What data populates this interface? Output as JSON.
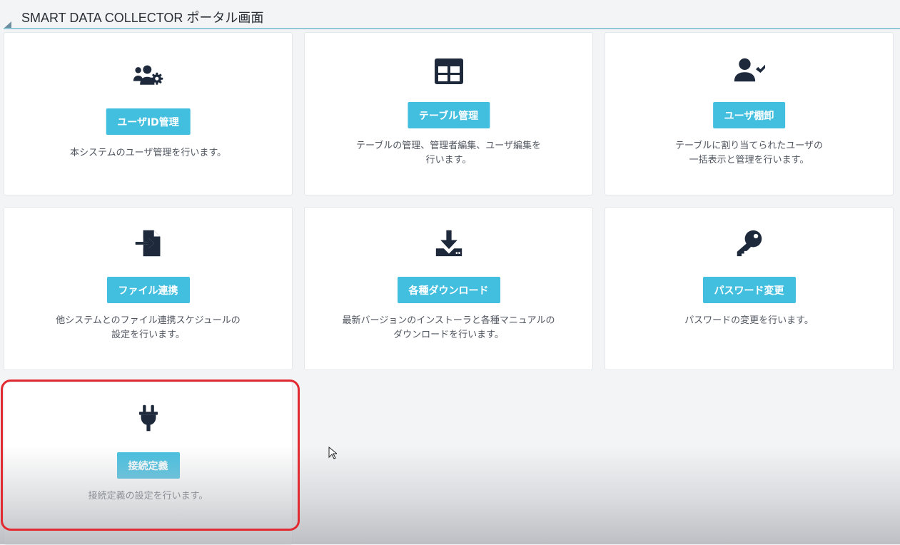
{
  "header": {
    "title": "SMART DATA COLLECTOR ポータル画面"
  },
  "cards": [
    {
      "icon": "users-cog-icon",
      "button_label": "ユーザID管理",
      "description": "本システムのユーザ管理を行います。"
    },
    {
      "icon": "table-icon",
      "button_label": "テーブル管理",
      "description": "テーブルの管理、管理者編集、ユーザ編集を\n行います。"
    },
    {
      "icon": "user-check-icon",
      "button_label": "ユーザ棚卸",
      "description": "テーブルに割り当てられたユーザの\n一括表示と管理を行います。"
    },
    {
      "icon": "file-import-icon",
      "button_label": "ファイル連携",
      "description": "他システムとのファイル連携スケジュールの\n設定を行います。"
    },
    {
      "icon": "download-icon",
      "button_label": "各種ダウンロード",
      "description": "最新バージョンのインストーラと各種マニュアルの\nダウンロードを行います。"
    },
    {
      "icon": "key-icon",
      "button_label": "パスワード変更",
      "description": "パスワードの変更を行います。"
    },
    {
      "icon": "plug-icon",
      "button_label": "接続定義",
      "description": "接続定義の設定を行います。"
    }
  ],
  "colors": {
    "accent_button": "#42bedf",
    "highlight_border": "#e32a31",
    "icon_color": "#1e2a3c"
  }
}
